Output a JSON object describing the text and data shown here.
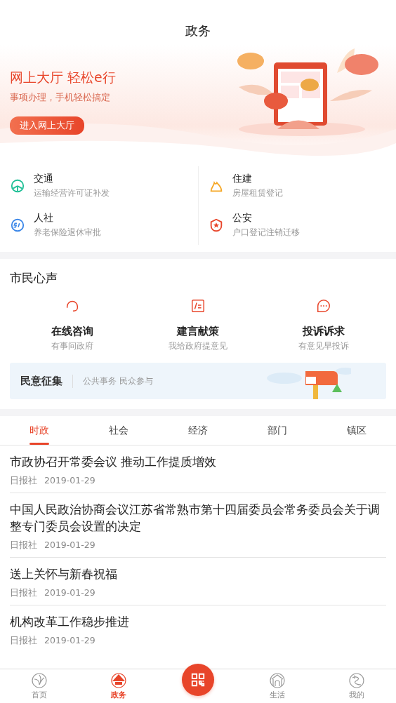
{
  "header": {
    "title": "政务"
  },
  "banner": {
    "headline": "网上大厅 轻松e行",
    "subtitle": "事项办理，手机轻松搞定",
    "button": "进入网上大厅"
  },
  "services": [
    {
      "kind": "traffic",
      "name": "交通",
      "desc": "运输经营许可证补发"
    },
    {
      "kind": "housing",
      "name": "住建",
      "desc": "房屋租赁登记"
    },
    {
      "kind": "social",
      "name": "人社",
      "desc": "养老保险退休审批"
    },
    {
      "kind": "police",
      "name": "公安",
      "desc": "户口登记注销迁移"
    }
  ],
  "voices": {
    "title": "市民心声",
    "items": [
      {
        "kind": "consult",
        "title": "在线咨询",
        "desc": "有事问政府"
      },
      {
        "kind": "suggest",
        "title": "建言献策",
        "desc": "我给政府提意见"
      },
      {
        "kind": "complain",
        "title": "投诉诉求",
        "desc": "有意见早投诉"
      }
    ],
    "poll": {
      "title": "民意征集",
      "subtitle": "公共事务 民众参与"
    }
  },
  "tabs": [
    {
      "label": "时政",
      "selected": true
    },
    {
      "label": "社会",
      "selected": false
    },
    {
      "label": "经济",
      "selected": false
    },
    {
      "label": "部门",
      "selected": false
    },
    {
      "label": "镇区",
      "selected": false
    }
  ],
  "news": [
    {
      "title": "市政协召开常委会议 推动工作提质增效",
      "source": "日报社",
      "date": "2019-01-29"
    },
    {
      "title": "中国人民政治协商会议江苏省常熟市第十四届委员会常务委员会关于调整专门委员会设置的决定",
      "source": "日报社",
      "date": "2019-01-29"
    },
    {
      "title": "送上关怀与新春祝福",
      "source": "日报社",
      "date": "2019-01-29"
    },
    {
      "title": "机构改革工作稳步推进",
      "source": "日报社",
      "date": "2019-01-29"
    }
  ],
  "nav": [
    {
      "kind": "home",
      "label": "首页",
      "selected": false
    },
    {
      "kind": "gov",
      "label": "政务",
      "selected": true
    },
    {
      "kind": "scan"
    },
    {
      "kind": "life",
      "label": "生活",
      "selected": false
    },
    {
      "kind": "me",
      "label": "我的",
      "selected": false
    }
  ]
}
